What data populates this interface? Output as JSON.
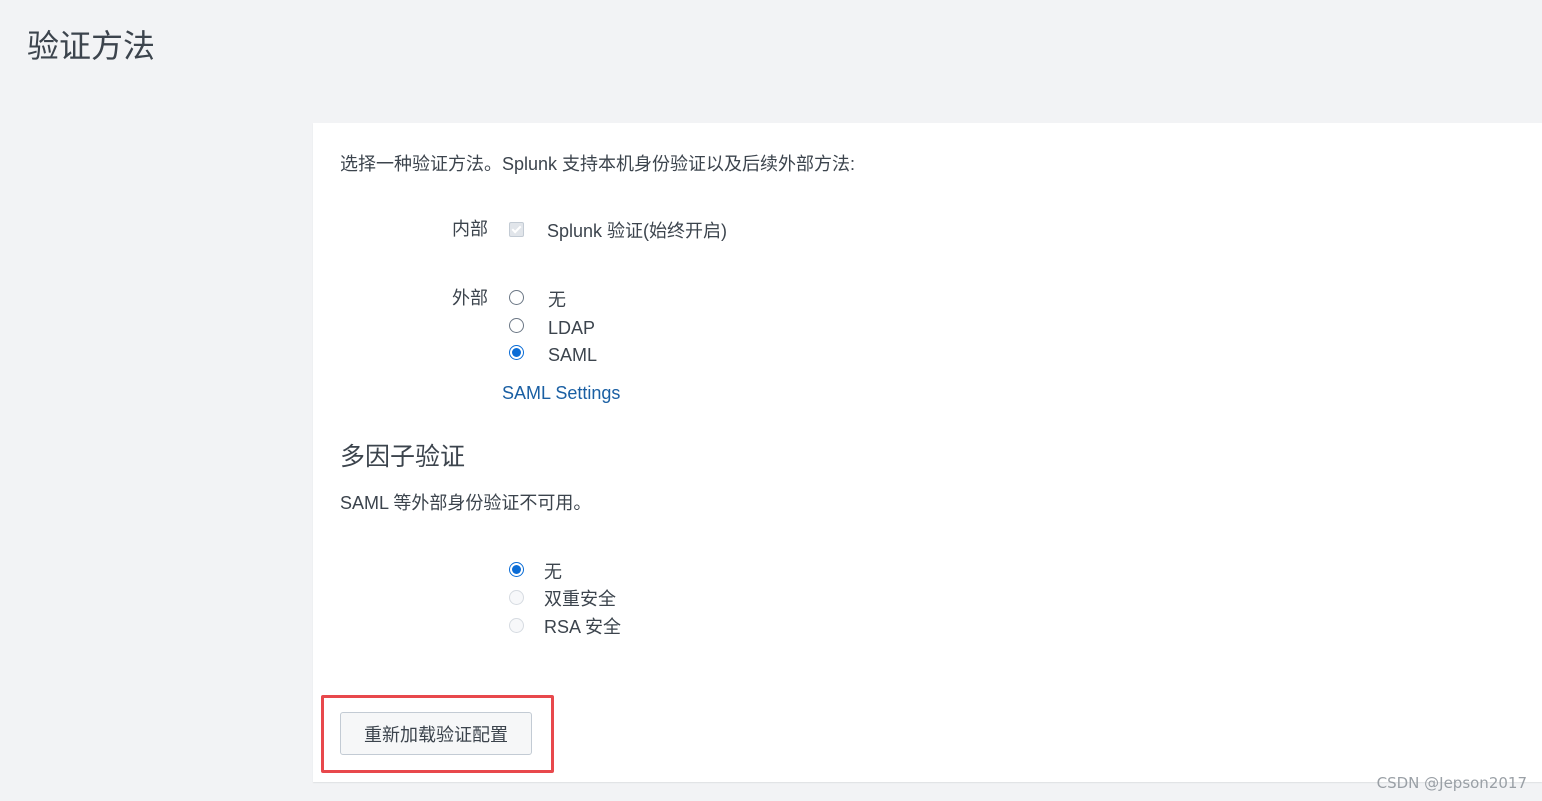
{
  "page": {
    "title": "验证方法"
  },
  "auth": {
    "intro": "选择一种验证方法。Splunk 支持本机身份验证以及后续外部方法:",
    "internal_label": "内部",
    "internal_option": "Splunk 验证(始终开启)",
    "external_label": "外部",
    "external_options": [
      {
        "label": "无",
        "selected": false
      },
      {
        "label": "LDAP",
        "selected": false
      },
      {
        "label": "SAML",
        "selected": true
      }
    ],
    "saml_settings_link": "SAML Settings"
  },
  "mfa": {
    "title": "多因子验证",
    "description": "SAML 等外部身份验证不可用。",
    "options": [
      {
        "label": "无",
        "selected": true,
        "enabled": true
      },
      {
        "label": "双重安全",
        "selected": false,
        "enabled": false
      },
      {
        "label": "RSA 安全",
        "selected": false,
        "enabled": false
      }
    ]
  },
  "actions": {
    "reload_button": "重新加载验证配置"
  },
  "watermark": "CSDN @Jepson2017",
  "colors": {
    "accent": "#0a6cd6",
    "link": "#1a5fa3",
    "highlight": "#e8484c"
  }
}
